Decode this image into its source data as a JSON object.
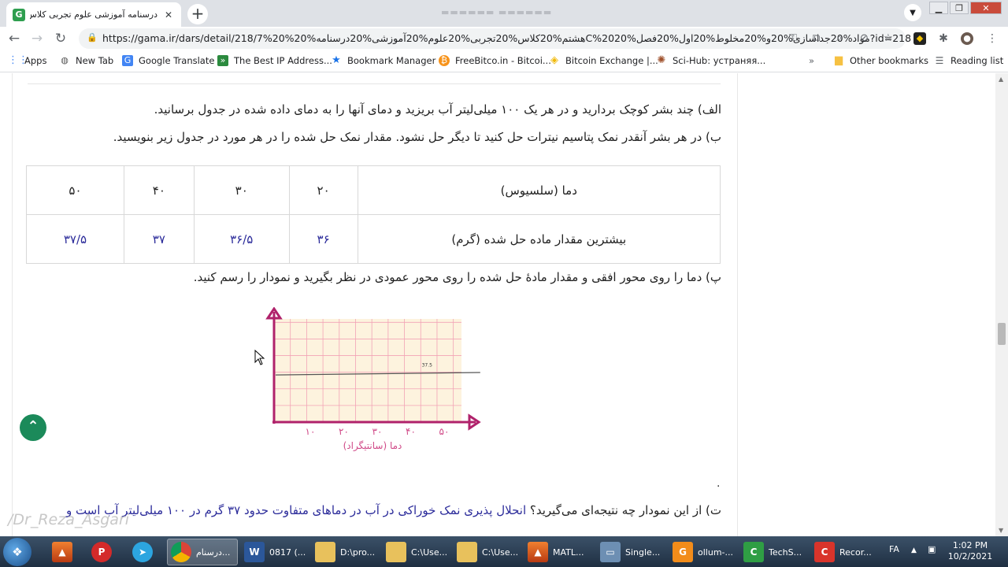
{
  "browser": {
    "tab_title": "درسنامه آموزشی علوم تجربی کلاس هشتم",
    "url": "https://gama.ir/dars/detail/218/7%20%هشتم20%کلاس%20تجربی%20علوم%20آموزشی%20درسنامه%20C%20مواد%20جداسازی%20و%20مخلوط%20اول%20فصل%20?id=218"
  },
  "bookmarks": [
    {
      "label": "Apps"
    },
    {
      "label": "New Tab"
    },
    {
      "label": "Google Translate"
    },
    {
      "label": "The Best IP Address..."
    },
    {
      "label": "Bookmark Manager"
    },
    {
      "label": "FreeBitco.in - Bitcoi..."
    },
    {
      "label": "Bitcoin Exchange |..."
    },
    {
      "label": "Sci-Hub: устраняя..."
    },
    {
      "label": "Other bookmarks"
    },
    {
      "label": "Reading list"
    }
  ],
  "content": {
    "para_a": "الف) چند بشر کوچک بردارید و در هر یک ۱۰۰ میلی‌لیتر آب بریزید و دمای آنها را به دمای داده شده در جدول برسانید.",
    "para_b": "ب) در هر بشر آنقدر نمک پتاسیم نیترات حل کنید تا دیگر حل نشود. مقدار نمک حل شده را در هر مورد در جدول زیر بنویسید.",
    "table": {
      "header": [
        "دما (سلسیوس)",
        "۲۰",
        "۳۰",
        "۴۰",
        "۵۰"
      ],
      "row": [
        "بیشترین مقدار ماده حل شده (گرم)",
        "۳۶",
        "۳۶/۵",
        "۳۷",
        "۳۷/۵"
      ]
    },
    "para_p": "پ) دما را روی محور افقی و مقدار مادهٔ حل شده را روی محور عمودی در نظر بگیرید و نمودار را رسم کنید.",
    "dot": ".",
    "question_prefix": "ت) از این نمودار چه نتیجه‌ای می‌گیرید؟",
    "question_answer": " انحلال پذیری نمک خوراکی در آب در دماهای متفاوت حدود ۳۷ گرم در ۱۰۰ میلی‌لیتر آب است و",
    "watermark": "/Dr_Reza_Asgari"
  },
  "chart_data": {
    "type": "line",
    "xlabel": "دما (سانتیگراد)",
    "x_ticks": [
      "۱۰",
      "۲۰",
      "۳۰",
      "۴۰",
      "۵۰"
    ],
    "x_values": [
      10,
      20,
      30,
      40,
      50
    ],
    "xlim": [
      0,
      60
    ],
    "ylim": [
      0,
      80
    ],
    "point_label": "37.5",
    "series": [
      {
        "values": [
          [
            0,
            36
          ],
          [
            60,
            37.9
          ]
        ]
      }
    ],
    "grid": true,
    "colors": {
      "axis": "#b0226b",
      "grid": "#f2a3b6",
      "background": "#fdf3de",
      "line": "#555555",
      "label": "#d04a88"
    }
  },
  "taskbar": {
    "items": [
      {
        "label": "",
        "icon": "matlab-icon"
      },
      {
        "label": "",
        "icon": "psiphon-icon"
      },
      {
        "label": "",
        "icon": "telegram-icon"
      },
      {
        "label": "درسنام...",
        "icon": "chrome-icon"
      },
      {
        "label": "0817 (...",
        "icon": "word-icon"
      },
      {
        "label": "D:\\pro...",
        "icon": "folder-icon"
      },
      {
        "label": "C:\\Use...",
        "icon": "folder-icon"
      },
      {
        "label": "C:\\Use...",
        "icon": "folder-icon"
      },
      {
        "label": "MATL...",
        "icon": "matlab-icon"
      },
      {
        "label": "Single...",
        "icon": "window-icon"
      },
      {
        "label": "ollum-...",
        "icon": "pdf-icon"
      },
      {
        "label": "TechS...",
        "icon": "techsmith-icon"
      },
      {
        "label": "Recor...",
        "icon": "camtasia-icon"
      }
    ],
    "language": "FA",
    "time": "1:02 PM",
    "date": "10/2/2021"
  }
}
